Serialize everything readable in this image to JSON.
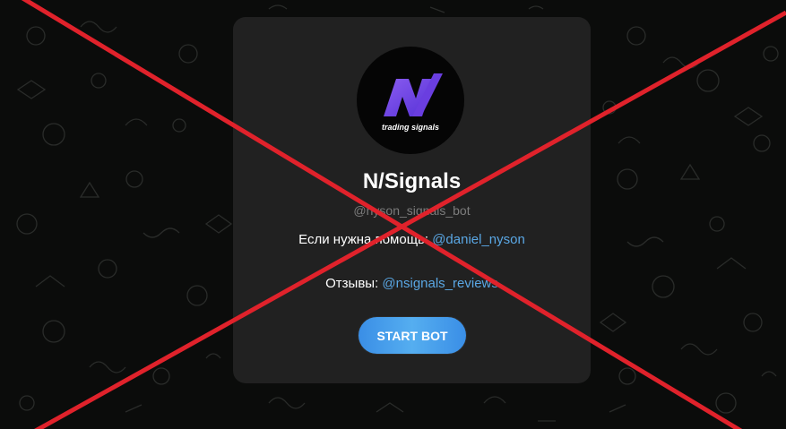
{
  "bot": {
    "logo_caption": "trading signals",
    "name": "N/Signals",
    "username": "@nyson_signals_bot",
    "help_prefix": "Если нужна помощь:",
    "help_link": "@daniel_nyson",
    "reviews_prefix": "Отзывы:",
    "reviews_link": "@nsignals_reviews",
    "start_button": "START BOT"
  },
  "colors": {
    "background": "#0b0c0b",
    "card": "#212121",
    "link": "#5aa7e4",
    "button": "#3a8ee6",
    "logo_purple": "#6a3ee0",
    "cross_red": "#e0222b"
  },
  "icons": {
    "background": "doodle-pattern",
    "overlay": "red-cross-mark",
    "logo": "n-signals-logo"
  }
}
